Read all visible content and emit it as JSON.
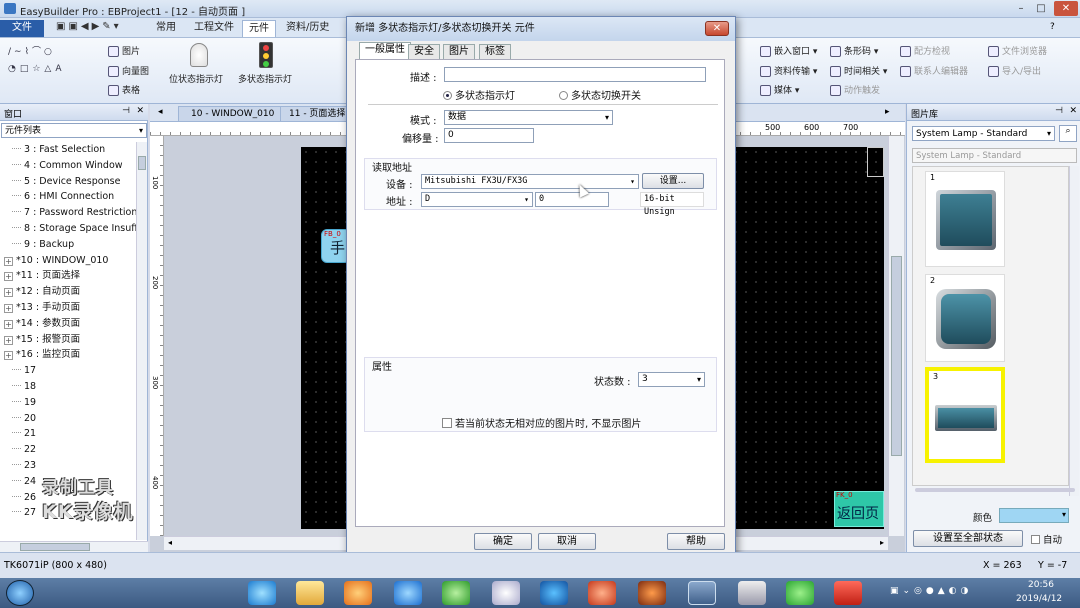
{
  "app": {
    "title": "EasyBuilder Pro : EBProject1 - [12 - 自动页面 ]"
  },
  "ribbon_tabs": [
    "文件",
    "常用",
    "工程文件",
    "元件",
    "资料/历史"
  ],
  "ribbon": {
    "left_group": [
      "图片",
      "向量图",
      "表格"
    ],
    "big_buttons": [
      "位状态指示灯",
      "多状态指示灯"
    ],
    "right_col1": [
      "嵌入窗口",
      "资料传输",
      "媒体"
    ],
    "right_col2": [
      "条形码",
      "时间相关",
      "动作触发"
    ],
    "right_col3": [
      "配方检视",
      "联系人编辑器"
    ],
    "right_col4": [
      "文件浏览器",
      "导入/导出"
    ]
  },
  "left_panel": {
    "header": "窗口",
    "combo": "元件列表",
    "items": [
      {
        "text": "3 : Fast Selection",
        "expand": false
      },
      {
        "text": "4 : Common Window",
        "expand": false
      },
      {
        "text": "5 : Device Response",
        "expand": false
      },
      {
        "text": "6 : HMI Connection",
        "expand": false
      },
      {
        "text": "7 : Password Restriction",
        "expand": false
      },
      {
        "text": "8 : Storage Space Insuff",
        "expand": false
      },
      {
        "text": "9 : Backup",
        "expand": false
      },
      {
        "text": "*10 : WINDOW_010",
        "expand": true
      },
      {
        "text": "*11 : 页面选择",
        "expand": true
      },
      {
        "text": "*12 : 自动页面",
        "expand": true
      },
      {
        "text": "*13 : 手动页面",
        "expand": true
      },
      {
        "text": "*14 : 参数页面",
        "expand": true
      },
      {
        "text": "*15 : 报警页面",
        "expand": true
      },
      {
        "text": "*16 : 监控页面",
        "expand": true
      },
      {
        "text": "17",
        "expand": false
      },
      {
        "text": "18",
        "expand": false
      },
      {
        "text": "19",
        "expand": false
      },
      {
        "text": "20",
        "expand": false
      },
      {
        "text": "21",
        "expand": false
      },
      {
        "text": "22",
        "expand": false
      },
      {
        "text": "23",
        "expand": false
      },
      {
        "text": "24",
        "expand": false
      },
      {
        "text": "26",
        "expand": false
      },
      {
        "text": "27",
        "expand": false
      }
    ]
  },
  "editor": {
    "tabs": [
      "10 - WINDOW_010",
      "11 - 页面选择"
    ],
    "ruler_labels": [
      "500",
      "600",
      "700"
    ],
    "side_ruler": [
      "100",
      "200",
      "300",
      "400"
    ],
    "fb_label": "FB_0",
    "fb_char": "手",
    "fk_label": "FK_0",
    "return_text": "返回页"
  },
  "watermark": {
    "line1": "录制工具",
    "line2": "KK录像机"
  },
  "right_panel": {
    "header": "图片库",
    "combo": "System Lamp - Standard",
    "subtitle": "System Lamp - Standard",
    "thumbs": [
      "1",
      "2",
      "3"
    ],
    "color_label": "颜色",
    "set_all_button": "设置至全部状态",
    "auto_label": "自动"
  },
  "dialog": {
    "title": "新增 多状态指示灯/多状态切换开关 元件",
    "tabs": [
      "一般属性",
      "安全",
      "图片",
      "标签"
    ],
    "desc_label": "描述 :",
    "desc_value": "",
    "radio1": "多状态指示灯",
    "radio2": "多状态切换开关",
    "mode_label": "模式 :",
    "mode_value": "数据",
    "offset_label": "偏移量 :",
    "offset_value": "0",
    "read_addr_title": "读取地址",
    "device_label": "设备 :",
    "device_value": "Mitsubishi FX3U/FX3G",
    "settings_button": "设置...",
    "address_label": "地址 :",
    "address_type": "D",
    "address_value": "0",
    "address_format": "16-bit Unsign",
    "props_title": "属性",
    "states_label": "状态数 :",
    "states_value": "3",
    "checkbox_label": "若当前状态无相对应的图片时, 不显示图片",
    "ok": "确定",
    "cancel": "取消",
    "help": "帮助"
  },
  "statusbar": {
    "model": "TK6071iP (800 x 480)",
    "x": "X = 263",
    "y": "Y = -7"
  },
  "taskbar": {
    "time": "20:56",
    "date": "2019/4/12"
  }
}
